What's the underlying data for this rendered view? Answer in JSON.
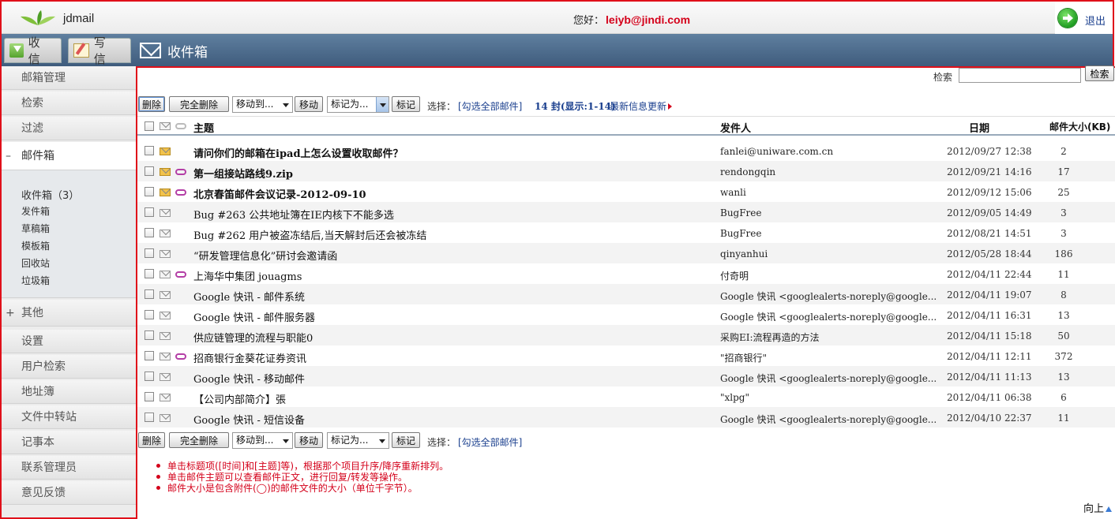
{
  "header": {
    "logo_text": "jdmail",
    "greeting_label": "您好：",
    "user_email": "leiyb@jindi.com",
    "logout_label": "退出"
  },
  "nav": {
    "inbox_label": "收 信",
    "compose_label": "写 信",
    "title": "收件箱"
  },
  "sidebar": {
    "items_top": [
      "邮箱管理",
      "检索",
      "过滤"
    ],
    "mailbox": {
      "prefix": "–",
      "label": "邮件箱"
    },
    "folders": [
      "收件箱（3）",
      "发件箱",
      "草稿箱",
      "模板箱",
      "回收站",
      "垃圾箱"
    ],
    "other": {
      "prefix": "+",
      "label": "其他"
    },
    "items_bottom": [
      "设置",
      "用户检索",
      "地址簿",
      "文件中转站",
      "记事本",
      "联系管理员",
      "意见反馈"
    ]
  },
  "search": {
    "label": "检索",
    "value": "",
    "button": "检索"
  },
  "toolbar": {
    "delete": "删除",
    "delete_all": "完全删除",
    "move_select": "移动到...",
    "move_btn": "移动",
    "mark_select": "标记为...",
    "mark_btn": "标记",
    "select_label": "选择：",
    "select_all": "[勾选全部邮件]",
    "count": "14 封(显示:1-14)",
    "refresh": "最新信息更新"
  },
  "table": {
    "headers": {
      "subject": "主题",
      "sender": "发件人",
      "date": "日期",
      "size": "邮件大小(KB)"
    },
    "rows": [
      {
        "subject": "请问你们的邮箱在ipad上怎么设置收取邮件？",
        "sender": "fanlei@uniware.com.cn",
        "date": "2012/09/27 12:38",
        "size": "2",
        "unread": true,
        "attach": false
      },
      {
        "subject": "第一组接站路线9.zip",
        "sender": "rendongqin",
        "date": "2012/09/21 14:16",
        "size": "17",
        "unread": true,
        "attach": true
      },
      {
        "subject": "北京春笛邮件会议记录-2012-09-10",
        "sender": "wanli",
        "date": "2012/09/12 15:06",
        "size": "25",
        "unread": true,
        "attach": true
      },
      {
        "subject": "Bug #263 公共地址簿在IE内核下不能多选",
        "sender": "BugFree",
        "date": "2012/09/05 14:49",
        "size": "3",
        "unread": false,
        "attach": false
      },
      {
        "subject": "Bug #262 用户被盗冻结后,当天解封后还会被冻结",
        "sender": "BugFree",
        "date": "2012/08/21 14:51",
        "size": "3",
        "unread": false,
        "attach": false
      },
      {
        "subject": "“研发管理信息化”研讨会邀请函",
        "sender": "qinyanhui",
        "date": "2012/05/28 18:44",
        "size": "186",
        "unread": false,
        "attach": false
      },
      {
        "subject": "上海华中集团 jouagms",
        "sender": "付奇明",
        "date": "2012/04/11 22:44",
        "size": "11",
        "unread": false,
        "attach": true
      },
      {
        "subject": "Google 快讯 - 邮件系统",
        "sender": "Google 快讯 <googlealerts-noreply@google...",
        "date": "2012/04/11 19:07",
        "size": "8",
        "unread": false,
        "attach": false
      },
      {
        "subject": "Google 快讯 - 邮件服务器",
        "sender": "Google 快讯 <googlealerts-noreply@google...",
        "date": "2012/04/11 16:31",
        "size": "13",
        "unread": false,
        "attach": false
      },
      {
        "subject": "供应链管理的流程与职能0",
        "sender": "采购EI:流程再造的方法",
        "date": "2012/04/11 15:18",
        "size": "50",
        "unread": false,
        "attach": false
      },
      {
        "subject": "招商银行金葵花证券资讯",
        "sender": "\"招商银行\"",
        "date": "2012/04/11 12:11",
        "size": "372",
        "unread": false,
        "attach": true
      },
      {
        "subject": "Google 快讯 - 移动邮件",
        "sender": "Google 快讯 <googlealerts-noreply@google...",
        "date": "2012/04/11 11:13",
        "size": "13",
        "unread": false,
        "attach": false
      },
      {
        "subject": "【公司内部简介】張",
        "sender": "\"xlpg\"",
        "date": "2012/04/11 06:38",
        "size": "6",
        "unread": false,
        "attach": false
      },
      {
        "subject": "Google 快讯 - 短信设备",
        "sender": "Google 快讯 <googlealerts-noreply@google...",
        "date": "2012/04/10 22:37",
        "size": "11",
        "unread": false,
        "attach": false
      }
    ]
  },
  "notes": [
    "单击标题项([时间]和[主题]等)，根据那个项目升序/降序重新排列。",
    "单击邮件主题可以查看邮件正文，进行回复/转发等操作。",
    "邮件大小是包含附件(◯)的邮件文件的大小（单位千字节）。"
  ],
  "back_top": "向上",
  "colors": {
    "accent_red": "#d4001a",
    "nav_blue": "#4a6889",
    "link_blue": "#1a3f8e"
  }
}
